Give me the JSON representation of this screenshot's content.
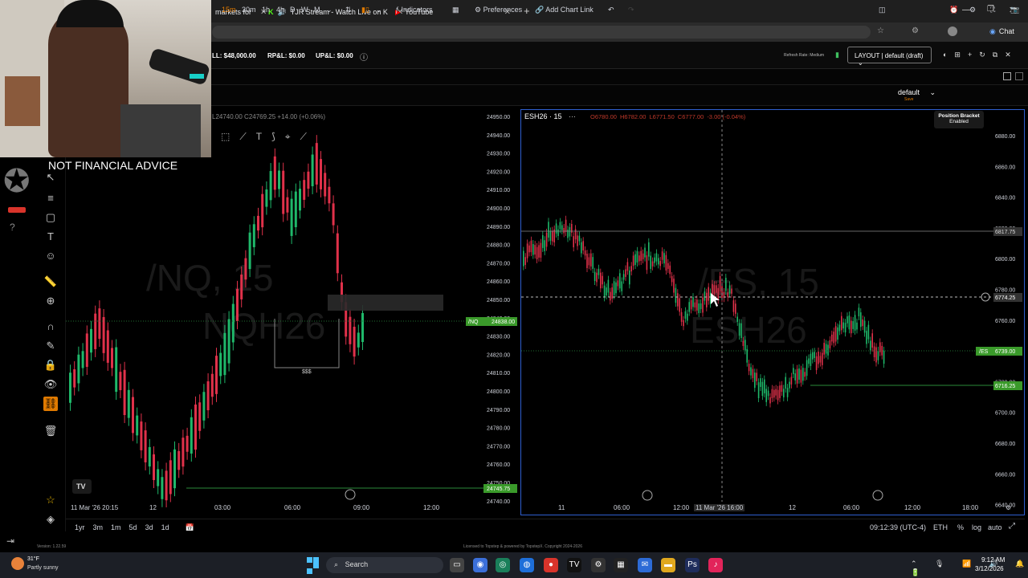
{
  "browser": {
    "tabs": [
      {
        "label": "markets for",
        "icon": "tradingview-icon"
      },
      {
        "label": "TJR Stream - Watch Live on K",
        "icon": "kick-icon"
      },
      {
        "label": "YouTube",
        "icon": "youtube-icon"
      }
    ],
    "chat_label": "Chat"
  },
  "account": {
    "rpl_label": "RP&L: $0.00",
    "upl_label": "UP&L: $0.00",
    "balance_label": "LL: $48,000.00",
    "refresh_label": "Refresh Rate: Medium",
    "layout_label": "LAYOUT | default (draft)"
  },
  "chart_toolbar": {
    "timeframes": [
      "15m",
      "30m",
      "1h",
      "4h",
      "D",
      "W",
      "M"
    ],
    "indicators_label": "Indicators",
    "preferences_label": "Preferences",
    "add_chart_link_label": "Add Chart Link",
    "template_label": "default",
    "template_sub": "Save"
  },
  "overlay": {
    "disclaimer": "NOT FINANCIAL ADVICE"
  },
  "nq_chart": {
    "ohlc_line": "L24740.00 C24769.25 +14.00 (+0.06%)",
    "watermark_line1": "/NQ, 15",
    "watermark_line2": "NQH26",
    "price_ticks": [
      "24950.00",
      "24940.00",
      "24930.00",
      "24920.00",
      "24910.00",
      "24900.00",
      "24890.00",
      "24880.00",
      "24870.00",
      "24860.00",
      "24850.00",
      "24840.00",
      "24830.00",
      "24820.00",
      "24810.00",
      "24800.00",
      "24790.00",
      "24780.00",
      "24770.00",
      "24760.00",
      "24750.00",
      "24740.00"
    ],
    "current_price_tag": "24838.00",
    "current_price_symbol": "/NQ",
    "level_tag": "24745.75",
    "liquidity_label": "$$$",
    "time_ticks": [
      "11 Mar '26  20:15",
      "12",
      "03:00",
      "06:00",
      "09:00",
      "12:00"
    ]
  },
  "es_chart": {
    "symbol_label": "ESH26 · 15",
    "ohlc": {
      "o": "O6780.00",
      "h": "H6782.00",
      "l": "L6771.50",
      "c": "C6777.00",
      "chg": "-3.00 (-0.04%)"
    },
    "watermark_line1": "/ES, 15",
    "watermark_line2": "ESH26",
    "position_bracket_label": "Position Bracket",
    "position_bracket_state": "Enabled",
    "price_ticks": [
      "6880.00",
      "6860.00",
      "6840.00",
      "6820.00",
      "6800.00",
      "6780.00",
      "6760.00",
      "6740.00",
      "6720.00",
      "6700.00",
      "6680.00",
      "6660.00",
      "6640.00"
    ],
    "level_high_tag": "6817.75",
    "crosshair_tag": "6774.25",
    "current_price_tag": "6739.00",
    "current_price_symbol": "/ES",
    "level_low_tag": "6716.25",
    "time_ticks": [
      "11",
      "06:00",
      "12:00",
      "11 Mar '26  16:00",
      "12",
      "06:00",
      "12:00",
      "18:00"
    ]
  },
  "range_bar": {
    "ranges": [
      "1yr",
      "3m",
      "1m",
      "5d",
      "3d",
      "1d"
    ],
    "clock": "09:12:39 (UTC-4)",
    "session": "ETH",
    "percent": "%",
    "log": "log",
    "auto": "auto"
  },
  "status": {
    "version": "Version: 1.22.59",
    "license": "Licensed to Topstep & powered by TopstepX. Copyright 2024-2026"
  },
  "taskbar": {
    "weather_temp": "31°F",
    "weather_desc": "Partly sunny",
    "search_label": "Search",
    "time": "9:12 AM",
    "date": "3/12/2026"
  }
}
